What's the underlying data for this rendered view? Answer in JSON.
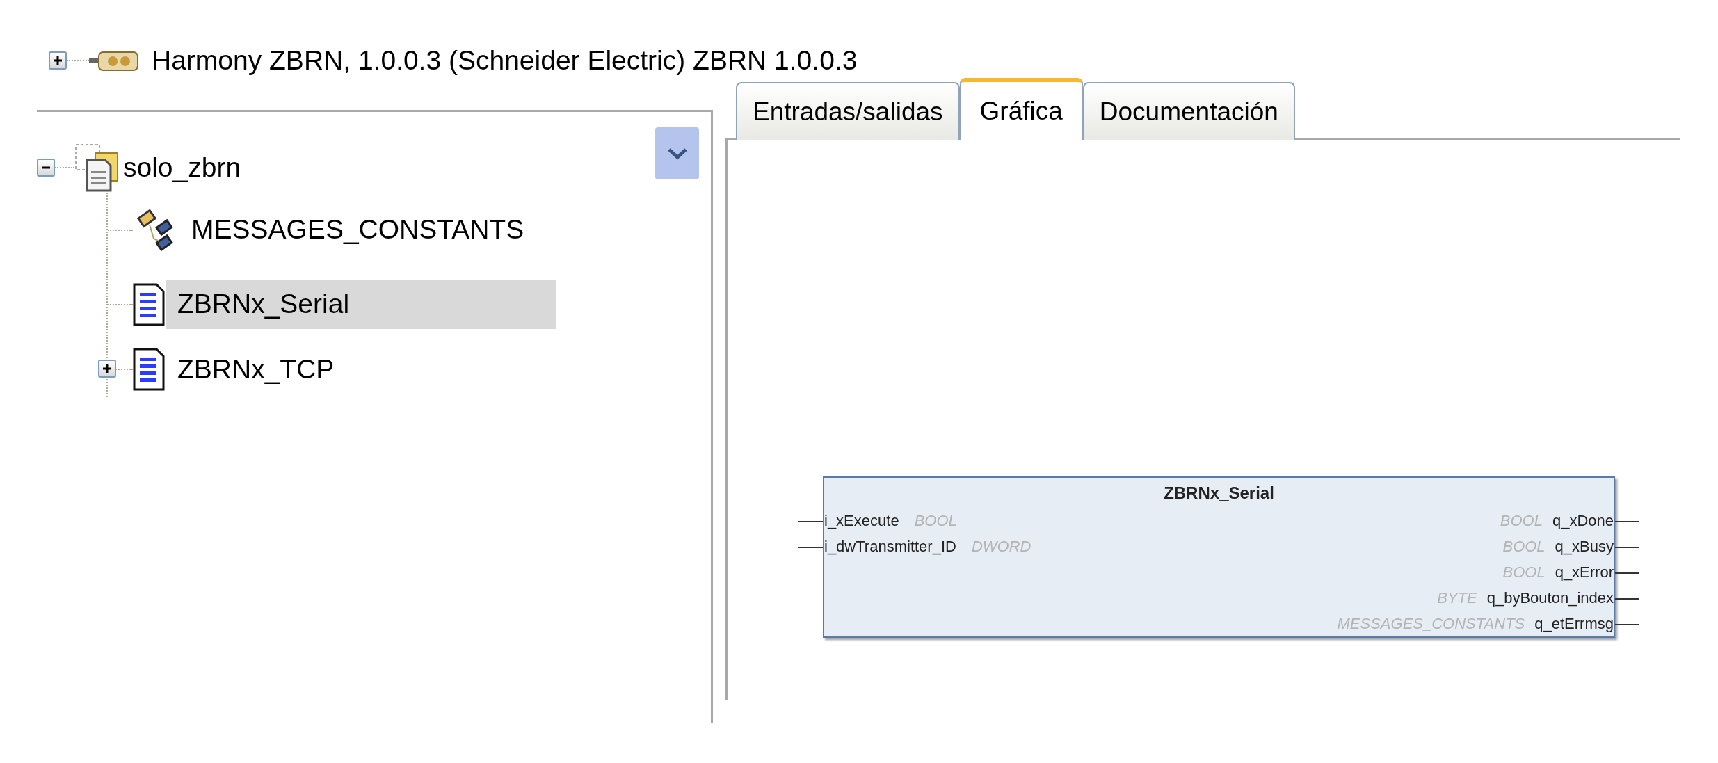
{
  "project": {
    "label": "Harmony ZBRN, 1.0.0.3 (Schneider Electric) ZBRN 1.0.0.3",
    "expanded": false
  },
  "tree": {
    "label": "solo_zbrn",
    "expanded": true,
    "children": [
      {
        "kind": "constants",
        "label": "MESSAGES_CONSTANTS",
        "selected": false
      },
      {
        "kind": "pou",
        "label": "ZBRNx_Serial",
        "selected": true
      },
      {
        "kind": "pou",
        "label": "ZBRNx_TCP",
        "selected": false,
        "expanded": false
      }
    ]
  },
  "tabs": [
    {
      "label": "Entradas/salidas",
      "selected": false
    },
    {
      "label": "Gráfica",
      "selected": true
    },
    {
      "label": "Documentación",
      "selected": false
    }
  ],
  "block": {
    "title": "ZBRNx_Serial",
    "inputs": [
      {
        "name": "i_xExecute",
        "type": "BOOL"
      },
      {
        "name": "i_dwTransmitter_ID",
        "type": "DWORD"
      }
    ],
    "outputs": [
      {
        "type": "BOOL",
        "name": "q_xDone"
      },
      {
        "type": "BOOL",
        "name": "q_xBusy"
      },
      {
        "type": "BOOL",
        "name": "q_xError"
      },
      {
        "type": "BYTE",
        "name": "q_byBouton_index"
      },
      {
        "type": "MESSAGES_CONSTANTS",
        "name": "q_etErrmsg"
      }
    ]
  }
}
